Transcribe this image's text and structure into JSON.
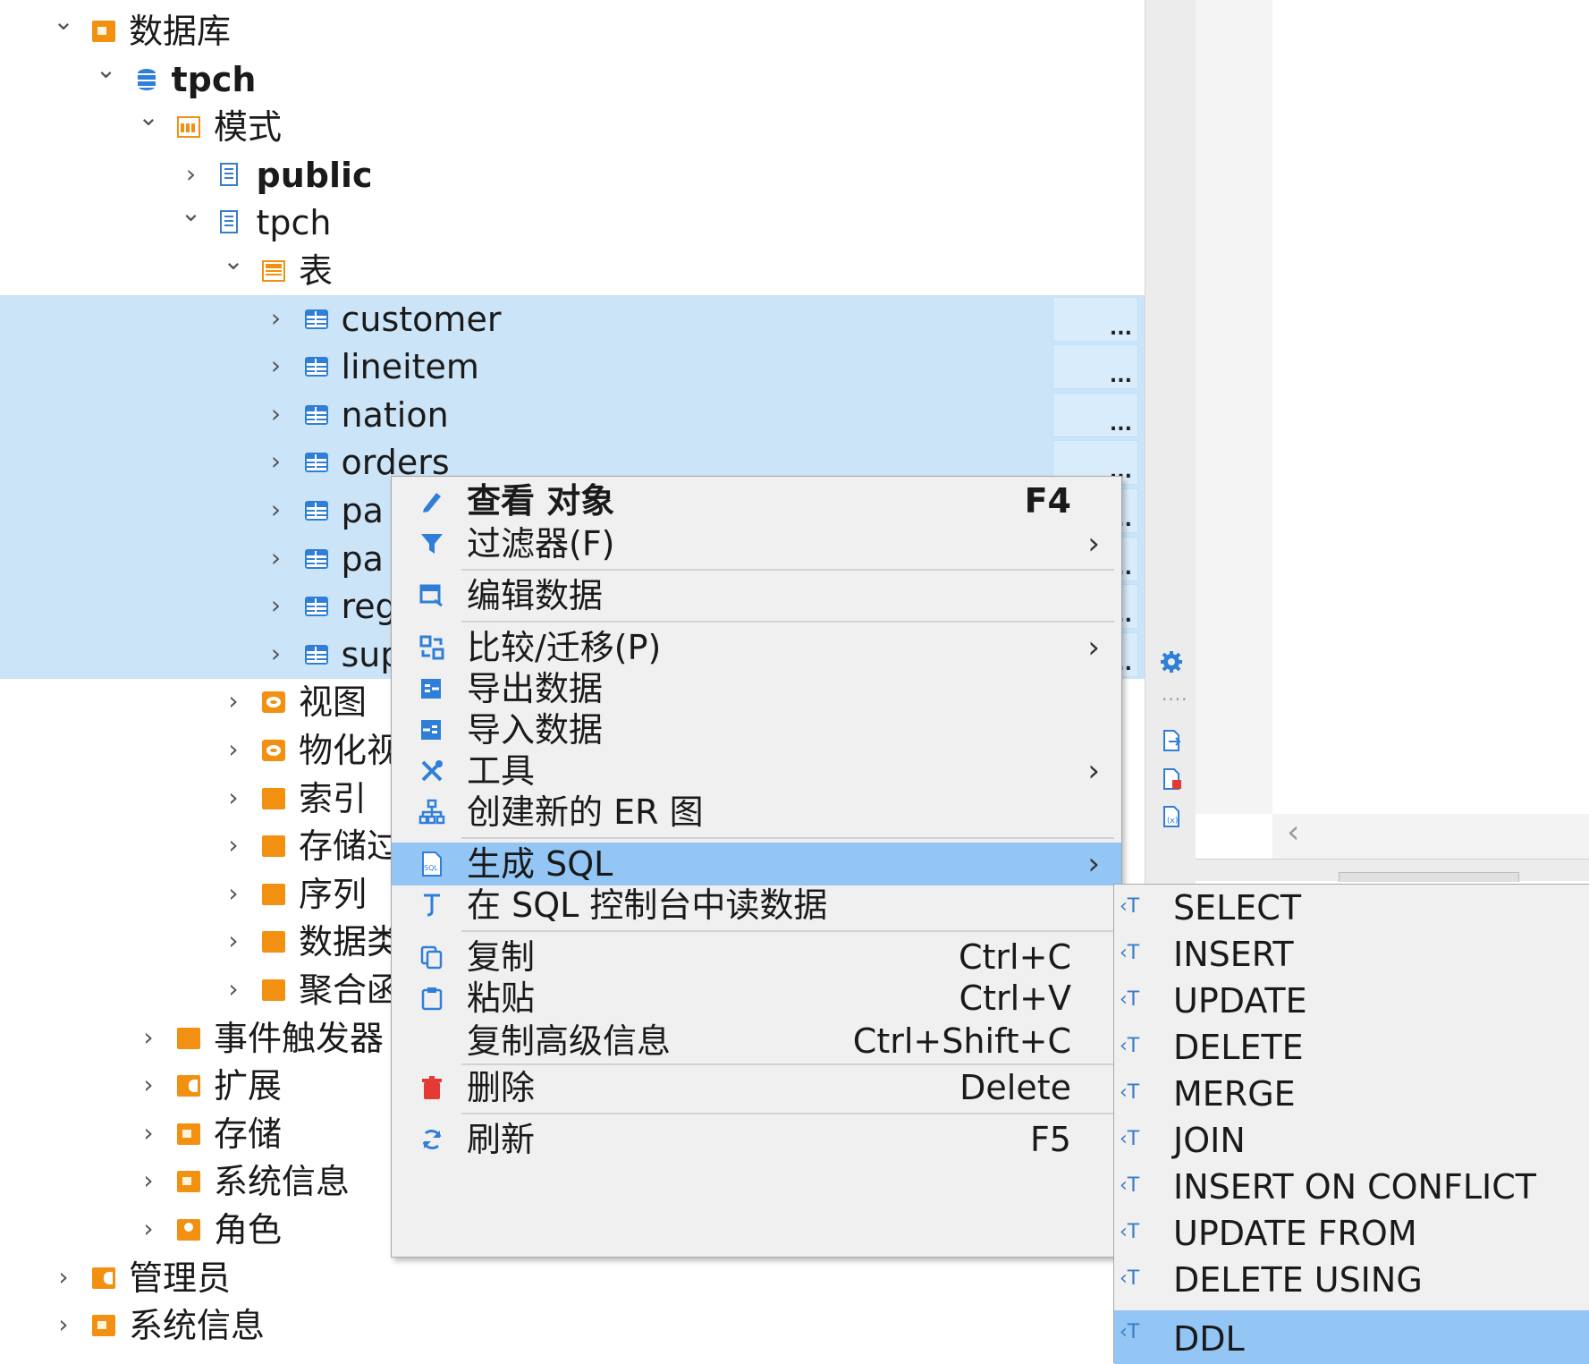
{
  "tree": [
    {
      "label": "数据库",
      "bold": false,
      "chevron": "expanded",
      "icon": "folder-icon",
      "indent": 0,
      "selected": false,
      "more": false
    },
    {
      "label": "tpch",
      "bold": true,
      "chevron": "expanded",
      "icon": "database-icon",
      "indent": 1,
      "selected": false,
      "more": false
    },
    {
      "label": "模式",
      "bold": false,
      "chevron": "expanded",
      "icon": "schemas-icon",
      "indent": 2,
      "selected": false,
      "more": false
    },
    {
      "label": "public",
      "bold": true,
      "chevron": "collapsed",
      "icon": "schema-icon",
      "indent": 3,
      "selected": false,
      "more": false
    },
    {
      "label": "tpch",
      "bold": false,
      "chevron": "expanded",
      "icon": "schema-icon",
      "indent": 3,
      "selected": false,
      "more": false
    },
    {
      "label": "表",
      "bold": false,
      "chevron": "expanded",
      "icon": "tables-folder-icon",
      "indent": 4,
      "selected": false,
      "more": false
    },
    {
      "label": "customer",
      "bold": false,
      "chevron": "collapsed",
      "icon": "table-icon",
      "indent": 5,
      "selected": true,
      "more": true
    },
    {
      "label": "lineitem",
      "bold": false,
      "chevron": "collapsed",
      "icon": "table-icon",
      "indent": 5,
      "selected": true,
      "more": true
    },
    {
      "label": "nation",
      "bold": false,
      "chevron": "collapsed",
      "icon": "table-icon",
      "indent": 5,
      "selected": true,
      "more": true
    },
    {
      "label": "orders",
      "bold": false,
      "chevron": "collapsed",
      "icon": "table-icon",
      "indent": 5,
      "selected": true,
      "more": true
    },
    {
      "label": "pa",
      "bold": false,
      "chevron": "collapsed",
      "icon": "table-icon",
      "indent": 5,
      "selected": true,
      "more": true
    },
    {
      "label": "pa",
      "bold": false,
      "chevron": "collapsed",
      "icon": "table-icon",
      "indent": 5,
      "selected": true,
      "more": true
    },
    {
      "label": "reg",
      "bold": false,
      "chevron": "collapsed",
      "icon": "table-icon",
      "indent": 5,
      "selected": true,
      "more": true
    },
    {
      "label": "sup",
      "bold": false,
      "chevron": "collapsed",
      "icon": "table-icon",
      "indent": 5,
      "selected": true,
      "more": true
    },
    {
      "label": "视图",
      "bold": false,
      "chevron": "collapsed",
      "icon": "views-icon",
      "indent": 4,
      "selected": false,
      "more": false
    },
    {
      "label": "物化视",
      "bold": false,
      "chevron": "collapsed",
      "icon": "views-icon",
      "indent": 4,
      "selected": false,
      "more": false
    },
    {
      "label": "索引",
      "bold": false,
      "chevron": "collapsed",
      "icon": "folder-plain-icon",
      "indent": 4,
      "selected": false,
      "more": false
    },
    {
      "label": "存储过",
      "bold": false,
      "chevron": "collapsed",
      "icon": "folder-plain-icon",
      "indent": 4,
      "selected": false,
      "more": false
    },
    {
      "label": "序列",
      "bold": false,
      "chevron": "collapsed",
      "icon": "folder-plain-icon",
      "indent": 4,
      "selected": false,
      "more": false
    },
    {
      "label": "数据类",
      "bold": false,
      "chevron": "collapsed",
      "icon": "folder-plain-icon",
      "indent": 4,
      "selected": false,
      "more": false
    },
    {
      "label": "聚合函",
      "bold": false,
      "chevron": "collapsed",
      "icon": "folder-plain-icon",
      "indent": 4,
      "selected": false,
      "more": false
    },
    {
      "label": "事件触发器",
      "bold": false,
      "chevron": "collapsed",
      "icon": "folder-plain-icon",
      "indent": 2,
      "selected": false,
      "more": false
    },
    {
      "label": "扩展",
      "bold": false,
      "chevron": "collapsed",
      "icon": "extensions-icon",
      "indent": 2,
      "selected": false,
      "more": false
    },
    {
      "label": "存储",
      "bold": false,
      "chevron": "collapsed",
      "icon": "folder-icon",
      "indent": 2,
      "selected": false,
      "more": false
    },
    {
      "label": "系统信息",
      "bold": false,
      "chevron": "collapsed",
      "icon": "folder-icon",
      "indent": 2,
      "selected": false,
      "more": false
    },
    {
      "label": "角色",
      "bold": false,
      "chevron": "collapsed",
      "icon": "roles-icon",
      "indent": 2,
      "selected": false,
      "more": false
    },
    {
      "label": "管理员",
      "bold": false,
      "chevron": "collapsed",
      "icon": "extensions-icon",
      "indent": 0,
      "selected": false,
      "more": false
    },
    {
      "label": "系统信息",
      "bold": false,
      "chevron": "collapsed",
      "icon": "folder-icon",
      "indent": 0,
      "selected": false,
      "more": false
    }
  ],
  "more_label": "...",
  "context_menu": [
    {
      "label": "查看 对象",
      "shortcut": "F4",
      "icon": "pencil-icon",
      "bold": true,
      "submenu": false,
      "highlight": false
    },
    {
      "label": "过滤器(F)",
      "shortcut": "",
      "icon": "filter-icon",
      "bold": false,
      "submenu": true,
      "highlight": false,
      "sep_after": true
    },
    {
      "label": "编辑数据",
      "shortcut": "",
      "icon": "edit-data-icon",
      "bold": false,
      "submenu": false,
      "highlight": false,
      "sep_after": true
    },
    {
      "label": "比较/迁移(P)",
      "shortcut": "",
      "icon": "compare-icon",
      "bold": false,
      "submenu": true,
      "highlight": false
    },
    {
      "label": "导出数据",
      "shortcut": "",
      "icon": "export-data-icon",
      "bold": false,
      "submenu": false,
      "highlight": false
    },
    {
      "label": "导入数据",
      "shortcut": "",
      "icon": "import-data-icon",
      "bold": false,
      "submenu": false,
      "highlight": false
    },
    {
      "label": "工具",
      "shortcut": "",
      "icon": "tools-icon",
      "bold": false,
      "submenu": true,
      "highlight": false
    },
    {
      "label": "创建新的 ER 图",
      "shortcut": "",
      "icon": "er-diagram-icon",
      "bold": false,
      "submenu": false,
      "highlight": false,
      "sep_after": true
    },
    {
      "label": "生成 SQL",
      "shortcut": "",
      "icon": "sql-icon",
      "bold": false,
      "submenu": true,
      "highlight": true
    },
    {
      "label": "在 SQL 控制台中读数据",
      "shortcut": "",
      "icon": "console-icon",
      "bold": false,
      "submenu": false,
      "highlight": false,
      "sep_after": true
    },
    {
      "label": "复制",
      "shortcut": "Ctrl+C",
      "icon": "copy-icon",
      "bold": false,
      "submenu": false,
      "highlight": false
    },
    {
      "label": "粘贴",
      "shortcut": "Ctrl+V",
      "icon": "paste-icon",
      "bold": false,
      "submenu": false,
      "highlight": false
    },
    {
      "label": "复制高级信息",
      "shortcut": "Ctrl+Shift+C",
      "icon": "",
      "bold": false,
      "submenu": false,
      "highlight": false,
      "sep_after": true
    },
    {
      "label": "删除",
      "shortcut": "Delete",
      "icon": "delete-icon",
      "bold": false,
      "submenu": false,
      "highlight": false,
      "sep_after": true
    },
    {
      "label": "刷新",
      "shortcut": "F5",
      "icon": "refresh-icon",
      "bold": false,
      "submenu": false,
      "highlight": false
    }
  ],
  "generate_sql_submenu": [
    {
      "label": "SELECT",
      "highlight": false
    },
    {
      "label": "INSERT",
      "highlight": false
    },
    {
      "label": "UPDATE",
      "highlight": false
    },
    {
      "label": "DELETE",
      "highlight": false
    },
    {
      "label": "MERGE",
      "highlight": false
    },
    {
      "label": "JOIN",
      "highlight": false
    },
    {
      "label": "INSERT ON CONFLICT",
      "highlight": false
    },
    {
      "label": "UPDATE FROM",
      "highlight": false
    },
    {
      "label": "DELETE USING",
      "highlight": false
    },
    {
      "label": "DDL",
      "highlight": true
    }
  ],
  "submenu_icon_glyph": "‹T",
  "colors": {
    "selection": "#cce4f7",
    "menu_highlight": "#93c6f5",
    "folder_orange": "#f29111",
    "icon_blue": "#2f7fd8",
    "delete_red": "#e53935"
  }
}
